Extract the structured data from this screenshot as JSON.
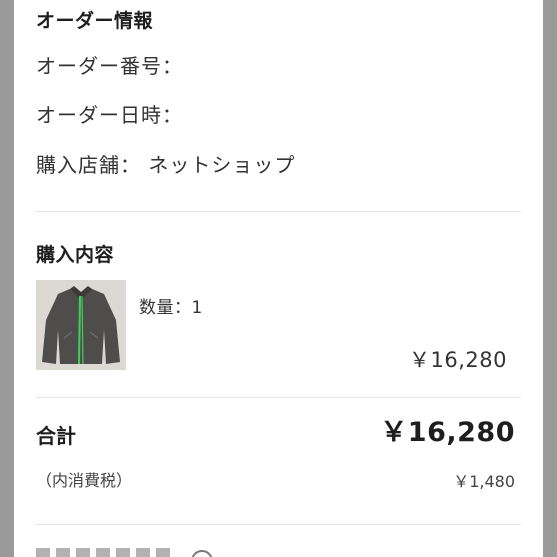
{
  "order_info": {
    "title": "オーダー情報",
    "order_number_label": "オーダー番号：",
    "order_datetime_label": "オーダー日時：",
    "store_label": "購入店舗：",
    "store_value": "ネットショップ"
  },
  "purchase": {
    "title": "購入内容",
    "item": {
      "image_icon": "jacket-photo",
      "quantity_text": "数量：1",
      "price": "￥16,280"
    }
  },
  "totals": {
    "total_label": "合計",
    "total_value": "￥16,280",
    "tax_label": "（内消費税）",
    "tax_value": "￥1,480"
  },
  "colors": {
    "frame": "#9a9a9a",
    "sheet": "#ffffff",
    "accent_zipper": "#3fd15a"
  }
}
